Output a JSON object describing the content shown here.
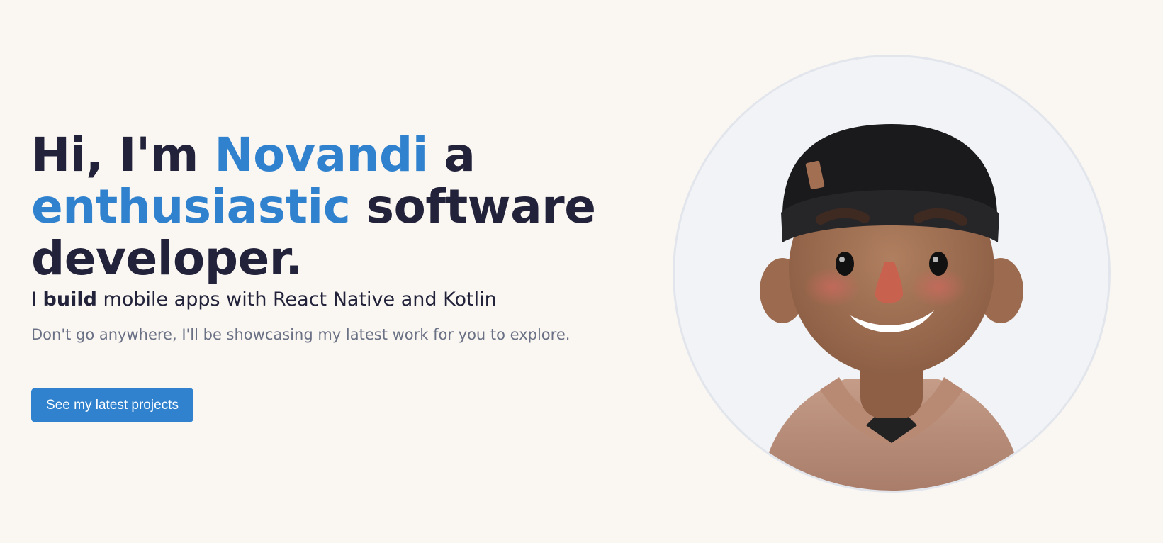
{
  "hero": {
    "headline": {
      "part1": "Hi, I'm ",
      "name": "Novandi",
      "part2": " a",
      "accent2": "enthusiastic",
      "part3": " software",
      "part4": "developer."
    },
    "tagline": {
      "prefix": "I ",
      "bold": "build",
      "suffix": " mobile apps with React Native and Kotlin"
    },
    "subtext": "Don't go anywhere, I'll be showcasing my latest work for you to explore.",
    "cta_label": "See my latest projects",
    "avatar_icon": "memoji-avatar-icon"
  },
  "colors": {
    "background": "#faf7f2",
    "accent": "#3182ce",
    "heading": "#22223a",
    "muted": "#6b7185",
    "avatar_bg": "#f1f3f6"
  }
}
